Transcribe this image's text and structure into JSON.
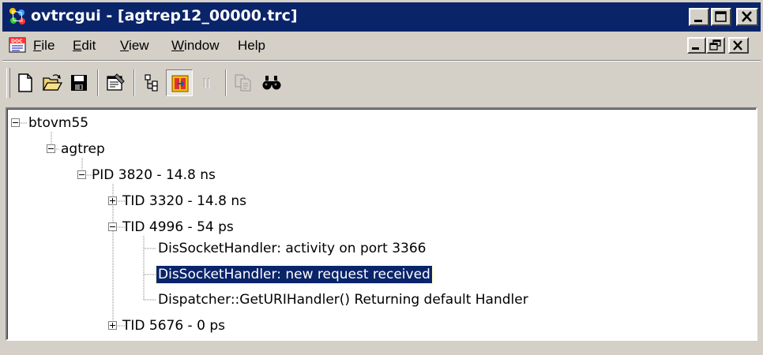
{
  "window": {
    "title": "ovtrcgui - [agtrep12_00000.trc]",
    "title_bar_color": "#0a246a",
    "face_color": "#d4d0c8",
    "caption_buttons": [
      "minimize-icon",
      "maximize-icon",
      "close-icon"
    ]
  },
  "menu": {
    "icon": "doc-icon",
    "items": [
      {
        "label": "File",
        "mnemonic": "F",
        "rest": "ile"
      },
      {
        "label": "Edit",
        "mnemonic": "E",
        "rest": "dit"
      },
      {
        "label": "View",
        "mnemonic": "V",
        "rest": "iew"
      },
      {
        "label": "Window",
        "mnemonic": "W",
        "rest": "indow"
      },
      {
        "label": "Help",
        "mnemonic": "",
        "rest": "Help"
      }
    ],
    "mdi_buttons": [
      "minimize-icon",
      "restore-icon",
      "close-icon"
    ]
  },
  "toolbar": {
    "buttons": [
      {
        "icon": "new-document-icon"
      },
      {
        "icon": "open-folder-icon"
      },
      {
        "icon": "save-disk-icon"
      },
      {
        "icon": "properties-icon"
      },
      {
        "icon": "tree-view-icon"
      },
      {
        "icon": "filter-icon",
        "pressed": true
      },
      {
        "icon": "pause-icon",
        "disabled": true
      },
      {
        "icon": "copy-icon",
        "disabled": true
      },
      {
        "icon": "find-binoculars-icon"
      }
    ]
  },
  "tree": {
    "selected_color": "#0a246a",
    "nodes": [
      {
        "label": "btovm55",
        "level": 0,
        "expander": "minus"
      },
      {
        "label": "agtrep",
        "level": 1,
        "expander": "minus"
      },
      {
        "label": "PID 3820 - 14.8 ns",
        "level": 2,
        "expander": "minus"
      },
      {
        "label": "TID 3320 - 14.8 ns",
        "level": 3,
        "expander": "plus"
      },
      {
        "label": "TID 4996 - 54 ps",
        "level": 3,
        "expander": "minus"
      },
      {
        "label": "DisSocketHandler: activity on port 3366",
        "level": 4,
        "expander": "none"
      },
      {
        "label": "DisSocketHandler: new request received",
        "level": 4,
        "expander": "none",
        "selected": true
      },
      {
        "label": "Dispatcher::GetURIHandler() Returning default Handler",
        "level": 4,
        "expander": "none"
      },
      {
        "label": "TID 5676 - 0 ps",
        "level": 3,
        "expander": "plus"
      }
    ]
  }
}
